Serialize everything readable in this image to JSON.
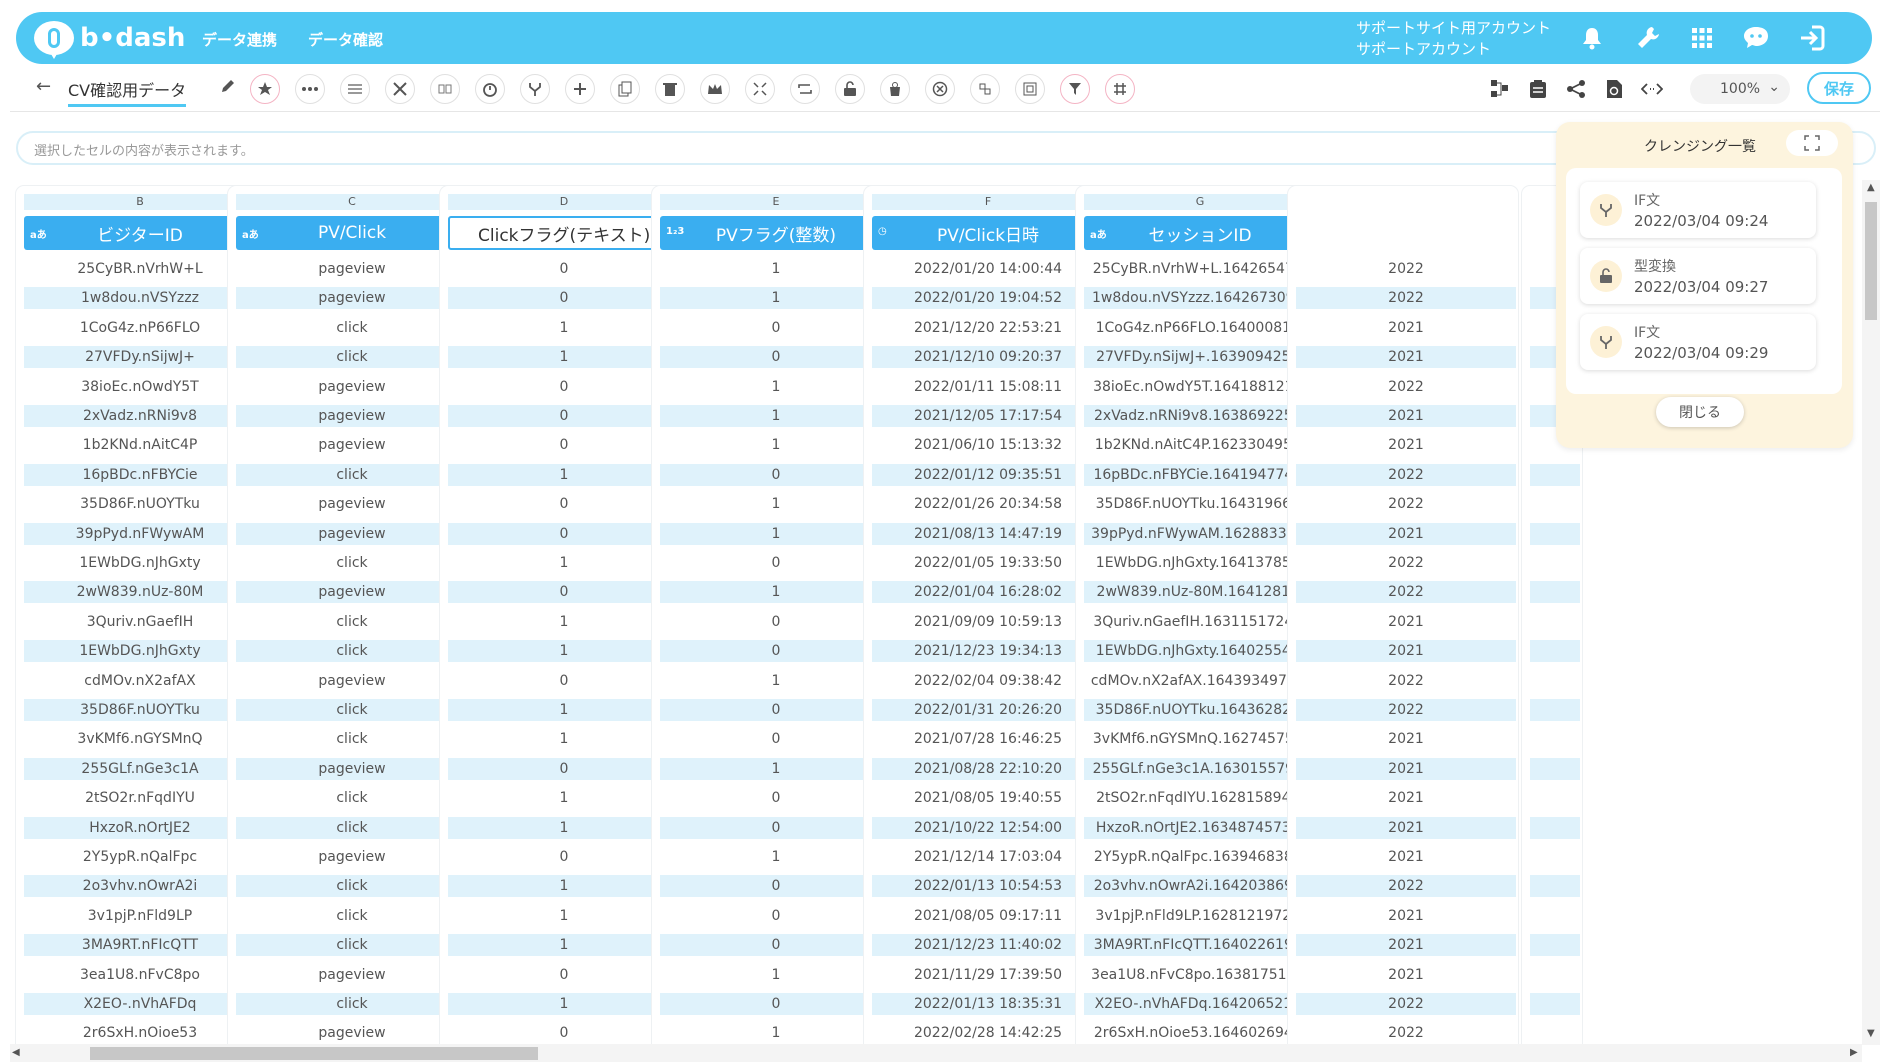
{
  "header": {
    "logo_text": "b•dash",
    "nav": [
      "データ連携",
      "データ確認"
    ],
    "account_line1": "サポートサイト用アカウント",
    "account_line2": "サポートアカウント"
  },
  "toolbar": {
    "back_label": "←",
    "sheet_name": "CV確認用データ",
    "zoom": "100%",
    "save_label": "保存"
  },
  "cellbar": {
    "placeholder": "選択したセルの内容が表示されます。"
  },
  "columns": [
    {
      "letter": "B",
      "type": "aあ",
      "title": "ビジターID"
    },
    {
      "letter": "C",
      "type": "aあ",
      "title": "PV/Click"
    },
    {
      "letter": "D",
      "type": "",
      "title": "Clickフラグ(テキスト)"
    },
    {
      "letter": "E",
      "type": "1₂3",
      "title": "PVフラグ(整数)"
    },
    {
      "letter": "F",
      "type": "◷",
      "title": "PV/Click日時"
    },
    {
      "letter": "G",
      "type": "aあ",
      "title": "セッションID"
    }
  ],
  "rows": [
    [
      "25CyBR.nVrhW+L",
      "pageview",
      "0",
      "1",
      "2022/01/20 14:00:44",
      "25CyBR.nVrhW+L.16426547...",
      "2022"
    ],
    [
      "1w8dou.nVSYzzz",
      "pageview",
      "0",
      "1",
      "2022/01/20 19:04:52",
      "1w8dou.nVSYzzz.164267309...",
      "2022"
    ],
    [
      "1CoG4z.nP66FLO",
      "click",
      "1",
      "0",
      "2021/12/20 22:53:21",
      "1CoG4z.nP66FLO.16400081...",
      "2021"
    ],
    [
      "27VFDy.nSijwJ+",
      "click",
      "1",
      "0",
      "2021/12/10 09:20:37",
      "27VFDy.nSijwJ+.163909425...",
      "2021"
    ],
    [
      "38ioEc.nOwdY5T",
      "pageview",
      "0",
      "1",
      "2022/01/11 15:08:11",
      "38ioEc.nOwdY5T.164188121...",
      "2022"
    ],
    [
      "2xVadz.nRNi9v8",
      "pageview",
      "0",
      "1",
      "2021/12/05 17:17:54",
      "2xVadz.nRNi9v8.163869225...",
      "2021"
    ],
    [
      "1b2KNd.nAitC4P",
      "pageview",
      "0",
      "1",
      "2021/06/10 15:13:32",
      "1b2KNd.nAitC4P.162330495...",
      "2021"
    ],
    [
      "16pBDc.nFBYCie",
      "click",
      "1",
      "0",
      "2022/01/12 09:35:51",
      "16pBDc.nFBYCie.164194774...",
      "2022"
    ],
    [
      "35D86F.nUOYTku",
      "pageview",
      "0",
      "1",
      "2022/01/26 20:34:58",
      "35D86F.nUOYTku.16431966...",
      "2022"
    ],
    [
      "39pPyd.nFWywAM",
      "pageview",
      "0",
      "1",
      "2021/08/13 14:47:19",
      "39pPyd.nFWywAM.16288336...",
      "2021"
    ],
    [
      "1EWbDG.nJhGxty",
      "click",
      "1",
      "0",
      "2022/01/05 19:33:50",
      "1EWbDG.nJhGxty.16413785...",
      "2022"
    ],
    [
      "2wW839.nUz-80M",
      "pageview",
      "0",
      "1",
      "2022/01/04 16:28:02",
      "2wW839.nUz-80M.1641281...",
      "2022"
    ],
    [
      "3Quriv.nGaefIH",
      "click",
      "1",
      "0",
      "2021/09/09 10:59:13",
      "3Quriv.nGaefIH.1631151724...",
      "2021"
    ],
    [
      "1EWbDG.nJhGxty",
      "click",
      "1",
      "0",
      "2021/12/23 19:34:13",
      "1EWbDG.nJhGxty.16402554...",
      "2021"
    ],
    [
      "cdMOv.nX2afAX",
      "pageview",
      "0",
      "1",
      "2022/02/04 09:38:42",
      "cdMOv.nX2afAX.1643934972...",
      "2022"
    ],
    [
      "35D86F.nUOYTku",
      "click",
      "1",
      "0",
      "2022/01/31 20:26:20",
      "35D86F.nUOYTku.16436282...",
      "2022"
    ],
    [
      "3vKMf6.nGYSMnQ",
      "click",
      "1",
      "0",
      "2021/07/28 16:46:25",
      "3vKMf6.nGYSMnQ.16274575...",
      "2021"
    ],
    [
      "255GLf.nGe3c1A",
      "pageview",
      "0",
      "1",
      "2021/08/28 22:10:20",
      "255GLf.nGe3c1A.163015579...",
      "2021"
    ],
    [
      "2tSO2r.nFqdIYU",
      "click",
      "1",
      "0",
      "2021/08/05 19:40:55",
      "2tSO2r.nFqdIYU.162815894...",
      "2021"
    ],
    [
      "HxzoR.nOrtJE2",
      "click",
      "1",
      "0",
      "2021/10/22 12:54:00",
      "HxzoR.nOrtJE2.1634874573...",
      "2021"
    ],
    [
      "2Y5ypR.nQalFpc",
      "pageview",
      "0",
      "1",
      "2021/12/14 17:03:04",
      "2Y5ypR.nQalFpc.163946838...",
      "2021"
    ],
    [
      "2o3vhv.nOwrA2i",
      "click",
      "1",
      "0",
      "2022/01/13 10:54:53",
      "2o3vhv.nOwrA2i.164203869...",
      "2022"
    ],
    [
      "3v1pjP.nFld9LP",
      "click",
      "1",
      "0",
      "2021/08/05 09:17:11",
      "3v1pjP.nFld9LP.1628121972...",
      "2021"
    ],
    [
      "3MA9RT.nFIcQTT",
      "click",
      "1",
      "0",
      "2021/12/23 11:40:02",
      "3MA9RT.nFIcQTT.164022619...",
      "2021"
    ],
    [
      "3ea1U8.nFvC8po",
      "pageview",
      "0",
      "1",
      "2021/11/29 17:39:50",
      "3ea1U8.nFvC8po.163817518...",
      "2021"
    ],
    [
      "X2EO-.nVhAFDq",
      "click",
      "1",
      "0",
      "2022/01/13 18:35:31",
      "X2EO-.nVhAFDq.164206521...",
      "2022"
    ],
    [
      "2r6SxH.nOioe53",
      "pageview",
      "0",
      "1",
      "2022/02/28 14:42:25",
      "2r6SxH.nOioe53.164602694...",
      "2022"
    ]
  ],
  "panel": {
    "title": "クレンジング一覧",
    "items": [
      {
        "name": "IF文",
        "date": "2022/03/04 09:24"
      },
      {
        "name": "型変換",
        "date": "2022/03/04 09:27"
      },
      {
        "name": "IF文",
        "date": "2022/03/04 09:29"
      }
    ],
    "close_label": "閉じる"
  }
}
